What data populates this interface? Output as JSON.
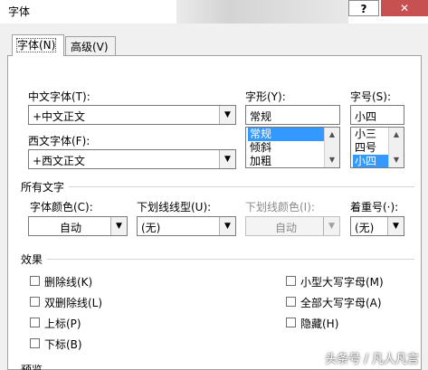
{
  "window": {
    "title": "字体",
    "help_label": "?",
    "close_label": "✕"
  },
  "tabs": [
    {
      "label": "字体(N)",
      "active": true
    },
    {
      "label": "高级(V)",
      "active": false
    }
  ],
  "chinese_font": {
    "label": "中文字体(T):",
    "value": "+中文正文"
  },
  "western_font": {
    "label": "西文字体(F):",
    "value": "+西文正文"
  },
  "font_style": {
    "label": "字形(Y):",
    "value": "常规",
    "options": [
      "常规",
      "倾斜",
      "加粗"
    ],
    "selected": "常规"
  },
  "font_size": {
    "label": "字号(S):",
    "value": "小四",
    "options": [
      "小三",
      "四号",
      "小四"
    ],
    "selected": "小四"
  },
  "all_text": {
    "heading": "所有文字",
    "font_color": {
      "label": "字体颜色(C):",
      "value": "自动"
    },
    "underline_style": {
      "label": "下划线线型(U):",
      "value": "(无)"
    },
    "underline_color": {
      "label": "下划线颜色(I):",
      "value": "自动"
    },
    "emphasis": {
      "label": "着重号(·):",
      "value": "(无)"
    }
  },
  "effects": {
    "heading": "效果",
    "left": [
      "删除线(K)",
      "双删除线(L)",
      "上标(P)",
      "下标(B)"
    ],
    "right": [
      "小型大写字母(M)",
      "全部大写字母(A)",
      "隐藏(H)"
    ]
  },
  "bottom_partial": "预览",
  "watermark": "头条号 / 凡人凡言",
  "colors": {
    "close_button": "#c75050",
    "selection": "#3399ff"
  }
}
